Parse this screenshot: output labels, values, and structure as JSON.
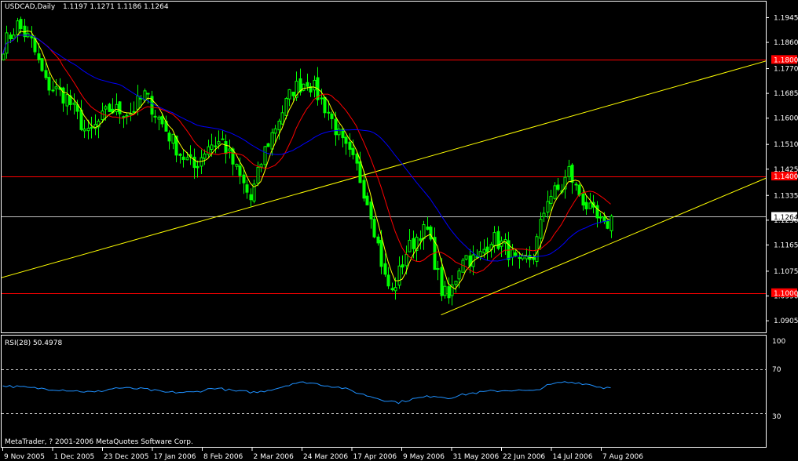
{
  "header": {
    "symbol": "USDCAD,Daily",
    "ohlc": "1.1197 1.1271 1.1186 1.1264"
  },
  "rsi": {
    "label": "RSI(28) 50.4978",
    "levels": [
      "100",
      "70",
      "30"
    ]
  },
  "copyright": "MetaTrader, ? 2001-2006 MetaQuotes Software Corp.",
  "colors": {
    "background": "#000000",
    "frame": "#ffffff",
    "candles": "#00ff00",
    "ma_fast": "#ffff00",
    "ma_medium": "#ff0000",
    "ma_slow": "#0000ff",
    "channel": "#ffff00",
    "hlines": "#ff0000",
    "current_line": "#c0c0c0",
    "rsi_line": "#1e90ff",
    "rsi_levels": "#c0c0c0"
  },
  "chart_data": {
    "type": "candlestick",
    "symbol": "USDCAD",
    "timeframe": "Daily",
    "ylim": [
      1.0865,
      1.2
    ],
    "price_ticks": [
      "1.1945",
      "1.1860",
      "1.1770",
      "1.1685",
      "1.1600",
      "1.1510",
      "1.1425",
      "1.1335",
      "1.1250",
      "1.1165",
      "1.1075",
      "1.0990",
      "1.0905"
    ],
    "x_ticks": [
      "9 Nov 2005",
      "1 Dec 2005",
      "23 Dec 2005",
      "17 Jan 2006",
      "8 Feb 2006",
      "2 Mar 2006",
      "24 Mar 2006",
      "17 Apr 2006",
      "9 May 2006",
      "31 May 2006",
      "22 Jun 2006",
      "14 Jul 2006",
      "7 Aug 2006"
    ],
    "horizontal_levels": [
      {
        "value": 1.18,
        "label": "1.1800"
      },
      {
        "value": 1.14,
        "label": "1.1400"
      },
      {
        "value": 1.1,
        "label": "1.1000"
      }
    ],
    "current_price": {
      "value": 1.1264,
      "label": "1.1264"
    },
    "price_waypoints": [
      [
        0,
        1.185
      ],
      [
        4,
        1.192
      ],
      [
        8,
        1.186
      ],
      [
        12,
        1.172
      ],
      [
        18,
        1.167
      ],
      [
        24,
        1.154
      ],
      [
        30,
        1.163
      ],
      [
        36,
        1.162
      ],
      [
        40,
        1.168
      ],
      [
        46,
        1.156
      ],
      [
        50,
        1.148
      ],
      [
        54,
        1.143
      ],
      [
        58,
        1.151
      ],
      [
        62,
        1.152
      ],
      [
        66,
        1.142
      ],
      [
        70,
        1.132
      ],
      [
        74,
        1.149
      ],
      [
        78,
        1.16
      ],
      [
        82,
        1.17
      ],
      [
        86,
        1.173
      ],
      [
        88,
        1.17
      ],
      [
        92,
        1.162
      ],
      [
        96,
        1.151
      ],
      [
        100,
        1.143
      ],
      [
        104,
        1.128
      ],
      [
        108,
        1.105
      ],
      [
        110,
        1.1
      ],
      [
        114,
        1.114
      ],
      [
        118,
        1.121
      ],
      [
        120,
        1.121
      ],
      [
        124,
        1.101
      ],
      [
        126,
        1.098
      ],
      [
        130,
        1.113
      ],
      [
        134,
        1.111
      ],
      [
        138,
        1.119
      ],
      [
        142,
        1.116
      ],
      [
        146,
        1.109
      ],
      [
        150,
        1.113
      ],
      [
        154,
        1.133
      ],
      [
        158,
        1.136
      ],
      [
        160,
        1.142
      ],
      [
        162,
        1.136
      ],
      [
        166,
        1.128
      ],
      [
        170,
        1.122
      ],
      [
        172,
        1.126
      ]
    ],
    "channel_lines": [
      {
        "from": [
          -55,
          1.0865
        ],
        "to": [
          220,
          1.181
        ]
      },
      {
        "from": [
          124,
          1.0925
        ],
        "to": [
          220,
          1.1415
        ]
      }
    ],
    "rsi_ylim": [
      0,
      100
    ],
    "rsi_levels": [
      30,
      70
    ],
    "rsi_waypoints": [
      [
        0,
        55
      ],
      [
        8,
        53
      ],
      [
        18,
        51
      ],
      [
        26,
        49
      ],
      [
        32,
        53
      ],
      [
        40,
        52
      ],
      [
        46,
        49
      ],
      [
        54,
        49
      ],
      [
        60,
        53
      ],
      [
        66,
        50
      ],
      [
        72,
        49
      ],
      [
        78,
        53
      ],
      [
        82,
        57
      ],
      [
        86,
        58
      ],
      [
        90,
        56
      ],
      [
        96,
        53
      ],
      [
        102,
        47
      ],
      [
        108,
        42
      ],
      [
        112,
        40
      ],
      [
        116,
        43
      ],
      [
        122,
        46
      ],
      [
        126,
        44
      ],
      [
        132,
        48
      ],
      [
        138,
        50
      ],
      [
        144,
        51
      ],
      [
        150,
        50
      ],
      [
        154,
        55
      ],
      [
        158,
        58
      ],
      [
        162,
        58
      ],
      [
        166,
        56
      ],
      [
        170,
        53
      ],
      [
        172,
        54
      ]
    ]
  }
}
